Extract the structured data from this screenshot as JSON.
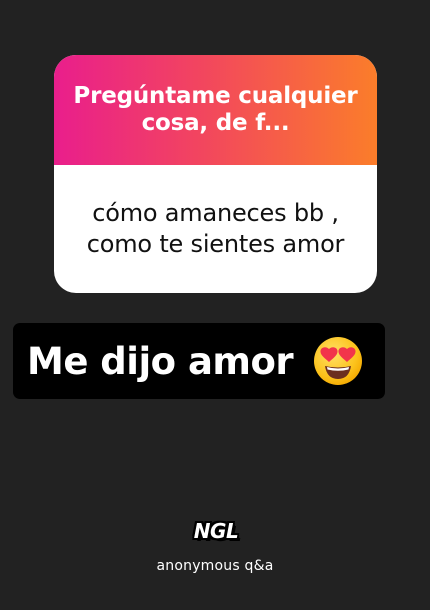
{
  "question_card": {
    "prompt": "Pregúntame cualquier cosa, de f...",
    "answer": "cómo amaneces bb , como te sientes amor",
    "gradient_colors": [
      "#e91e8c",
      "#fb7d2a"
    ]
  },
  "caption": {
    "text": "Me dijo amor",
    "emoji_icon": "heart-eyes-icon"
  },
  "footer": {
    "logo": "NGL",
    "tagline": "anonymous q&a"
  }
}
